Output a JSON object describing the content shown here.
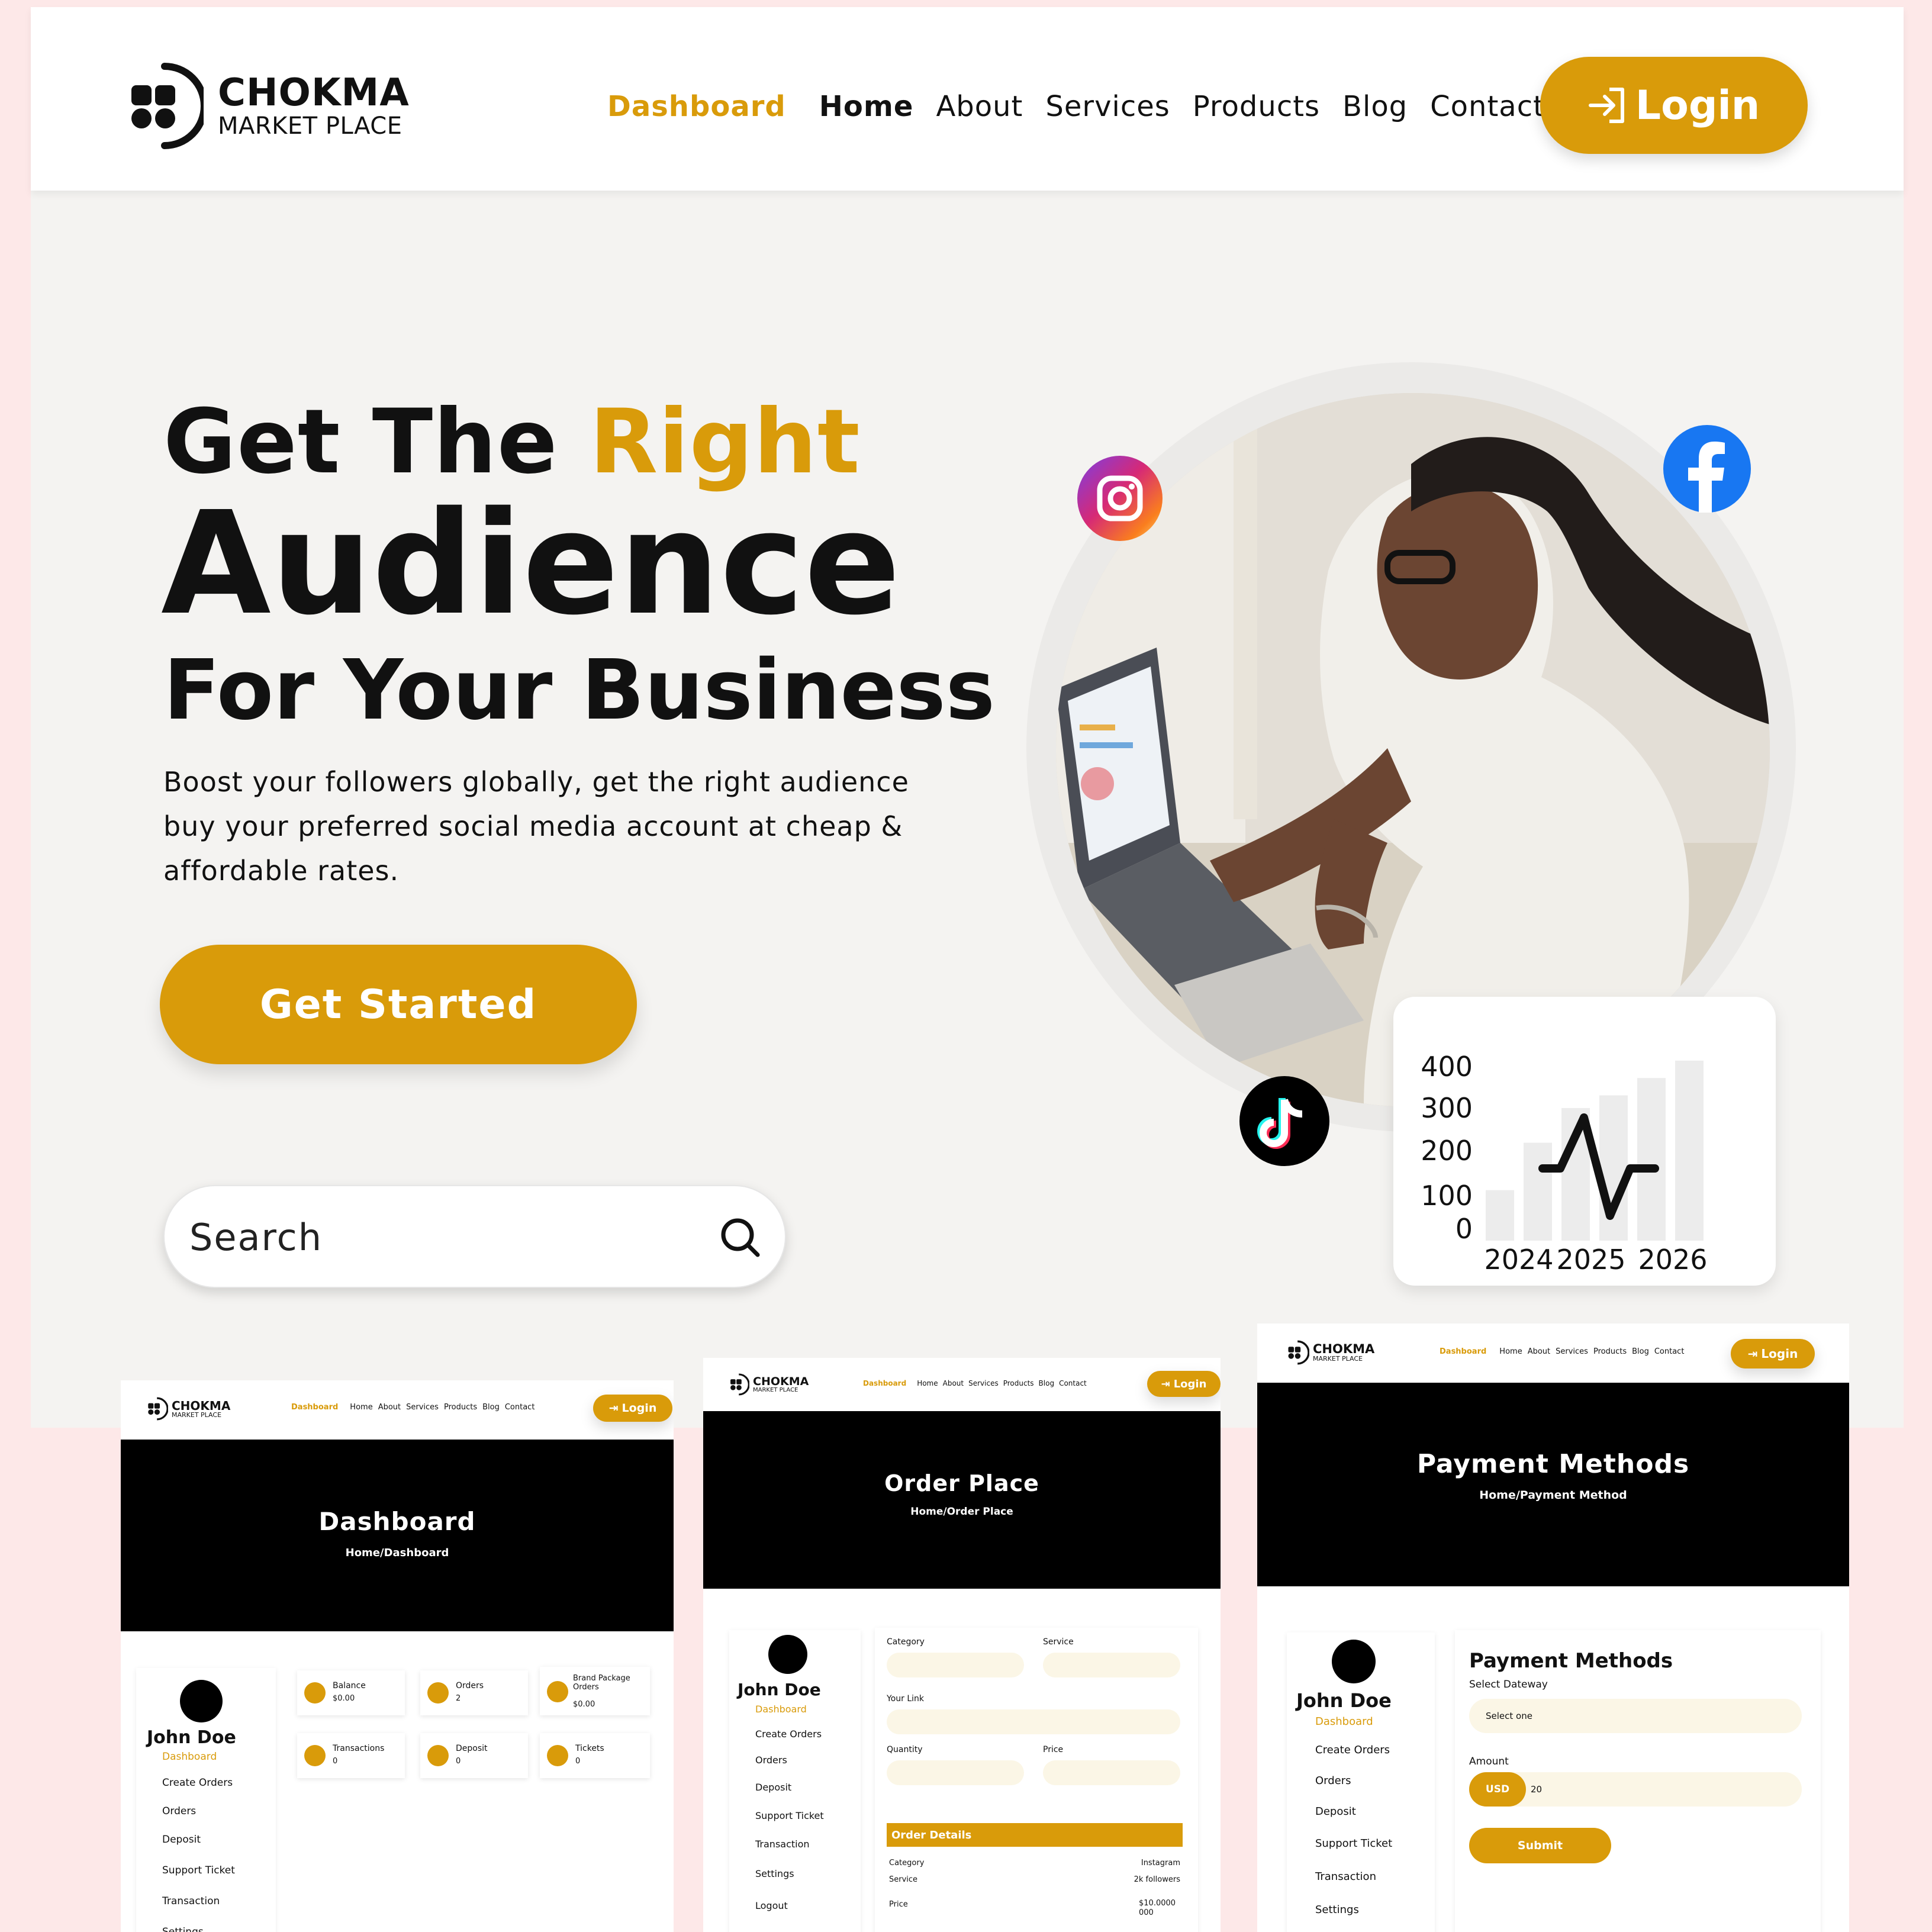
{
  "brand": {
    "line1": "CHOKMA",
    "line2": "MARKET PLACE"
  },
  "nav": {
    "dashboard": "Dashboard",
    "home": "Home",
    "about": "About",
    "services": "Services",
    "products": "Products",
    "blog": "Blog",
    "contact": "Contact",
    "login": "Login"
  },
  "hero": {
    "line1_a": "Get The ",
    "line1_b": "Right",
    "line2": "Audience",
    "line3": "For Your Business",
    "paragraph": "Boost your followers globally, get the right audience buy your preferred social media account at cheap & affordable rates.",
    "cta": "Get Started"
  },
  "search": {
    "placeholder": "Search"
  },
  "stats_card": {
    "y_ticks": [
      "400",
      "300",
      "200",
      "100",
      "0"
    ],
    "x_ticks": [
      "2024",
      "2025",
      "2026"
    ],
    "bars": [
      0.32,
      0.62,
      0.84,
      0.92,
      1.03,
      1.14
    ]
  },
  "colors": {
    "accent": "#d99b0a",
    "banner": "#000000",
    "page_bg": "#f4f3f1",
    "outer_bg": "#fde8e8"
  },
  "icons": [
    "instagram-icon",
    "facebook-icon",
    "tiktok-icon",
    "search-icon",
    "login-arrow-icon"
  ],
  "preview_dashboard": {
    "title": "Dashboard",
    "crumb": "Home/Dashboard",
    "user": "John Doe",
    "user_role": "Dashboard",
    "menu": [
      "Create Orders",
      "Orders",
      "Deposit",
      "Support Ticket",
      "Transaction",
      "Settings"
    ],
    "cards": [
      {
        "label": "Balance",
        "value": "$0.00"
      },
      {
        "label": "Orders",
        "value": "2"
      },
      {
        "label": "Brand Package Orders",
        "value": "$0.00"
      },
      {
        "label": "Transactions",
        "value": "0"
      },
      {
        "label": "Deposit",
        "value": "0"
      },
      {
        "label": "Tickets",
        "value": "0"
      }
    ]
  },
  "preview_order": {
    "title": "Order Place",
    "crumb": "Home/Order Place",
    "user": "John Doe",
    "user_role": "Dashboard",
    "menu": [
      "Create Orders",
      "Orders",
      "Deposit",
      "Support Ticket",
      "Transaction",
      "Settings",
      "Logout"
    ],
    "labels": {
      "category": "Category",
      "service": "Service",
      "link": "Your Link",
      "quantity": "Quantity",
      "price": "Price"
    },
    "details_title": "Order Details",
    "details": [
      {
        "k": "Category",
        "v": "Instagram"
      },
      {
        "k": "Service",
        "v": "2k followers"
      },
      {
        "k": "Price",
        "v": "$10.0000 000"
      }
    ]
  },
  "preview_payment": {
    "title": "Payment Methods",
    "crumb": "Home/Payment Method",
    "user": "John Doe",
    "user_role": "Dashboard",
    "menu": [
      "Create Orders",
      "Orders",
      "Deposit",
      "Support Ticket",
      "Transaction",
      "Settings"
    ],
    "heading": "Payment Methods",
    "gateway_label": "Select Dateway",
    "gateway_value": "Select one",
    "amount_label": "Amount",
    "currency": "USD",
    "amount": "20",
    "submit": "Submit"
  }
}
